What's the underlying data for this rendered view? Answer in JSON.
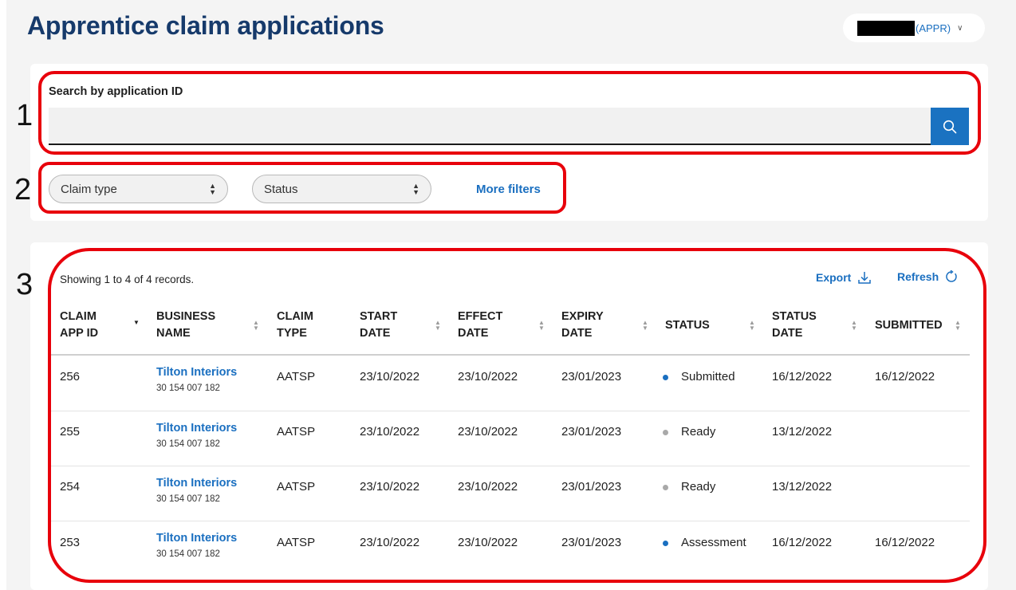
{
  "header": {
    "title": "Apprentice claim applications",
    "user_role": "(APPR)"
  },
  "search": {
    "label": "Search by application ID",
    "value": "",
    "placeholder": ""
  },
  "filters": {
    "claim_type": "Claim type",
    "status": "Status",
    "more_filters": "More filters"
  },
  "table": {
    "records_text": "Showing 1 to 4 of 4 records.",
    "export_label": "Export",
    "refresh_label": "Refresh",
    "columns": [
      {
        "line1": "CLAIM",
        "line2": "APP ID"
      },
      {
        "line1": "BUSINESS",
        "line2": "NAME"
      },
      {
        "line1": "CLAIM",
        "line2": "TYPE"
      },
      {
        "line1": "START",
        "line2": "DATE"
      },
      {
        "line1": "EFFECT",
        "line2": "DATE"
      },
      {
        "line1": "EXPIRY",
        "line2": "DATE"
      },
      {
        "line1": "STATUS",
        "line2": ""
      },
      {
        "line1": "STATUS",
        "line2": "DATE"
      },
      {
        "line1": "SUBMITTED",
        "line2": ""
      }
    ],
    "rows": [
      {
        "id": "256",
        "business": "Tilton Interiors",
        "abn": "30 154 007 182",
        "claim_type": "AATSP",
        "start": "23/10/2022",
        "effect": "23/10/2022",
        "expiry": "23/01/2023",
        "status": "Submitted",
        "status_color": "#1a6fc0",
        "status_date": "16/12/2022",
        "submitted": "16/12/2022"
      },
      {
        "id": "255",
        "business": "Tilton Interiors",
        "abn": "30 154 007 182",
        "claim_type": "AATSP",
        "start": "23/10/2022",
        "effect": "23/10/2022",
        "expiry": "23/01/2023",
        "status": "Ready",
        "status_color": "#a9a9a9",
        "status_date": "13/12/2022",
        "submitted": ""
      },
      {
        "id": "254",
        "business": "Tilton Interiors",
        "abn": "30 154 007 182",
        "claim_type": "AATSP",
        "start": "23/10/2022",
        "effect": "23/10/2022",
        "expiry": "23/01/2023",
        "status": "Ready",
        "status_color": "#a9a9a9",
        "status_date": "13/12/2022",
        "submitted": ""
      },
      {
        "id": "253",
        "business": "Tilton Interiors",
        "abn": "30 154 007 182",
        "claim_type": "AATSP",
        "start": "23/10/2022",
        "effect": "23/10/2022",
        "expiry": "23/01/2023",
        "status": "Assessment",
        "status_color": "#1a6fc0",
        "status_date": "16/12/2022",
        "submitted": "16/12/2022"
      }
    ]
  },
  "annotations": {
    "n1": "1",
    "n2": "2",
    "n3": "3",
    "color": "#e8000b"
  },
  "colors": {
    "title": "#163a6b",
    "link": "#1a6fc0",
    "search_button": "#1a72c1"
  }
}
